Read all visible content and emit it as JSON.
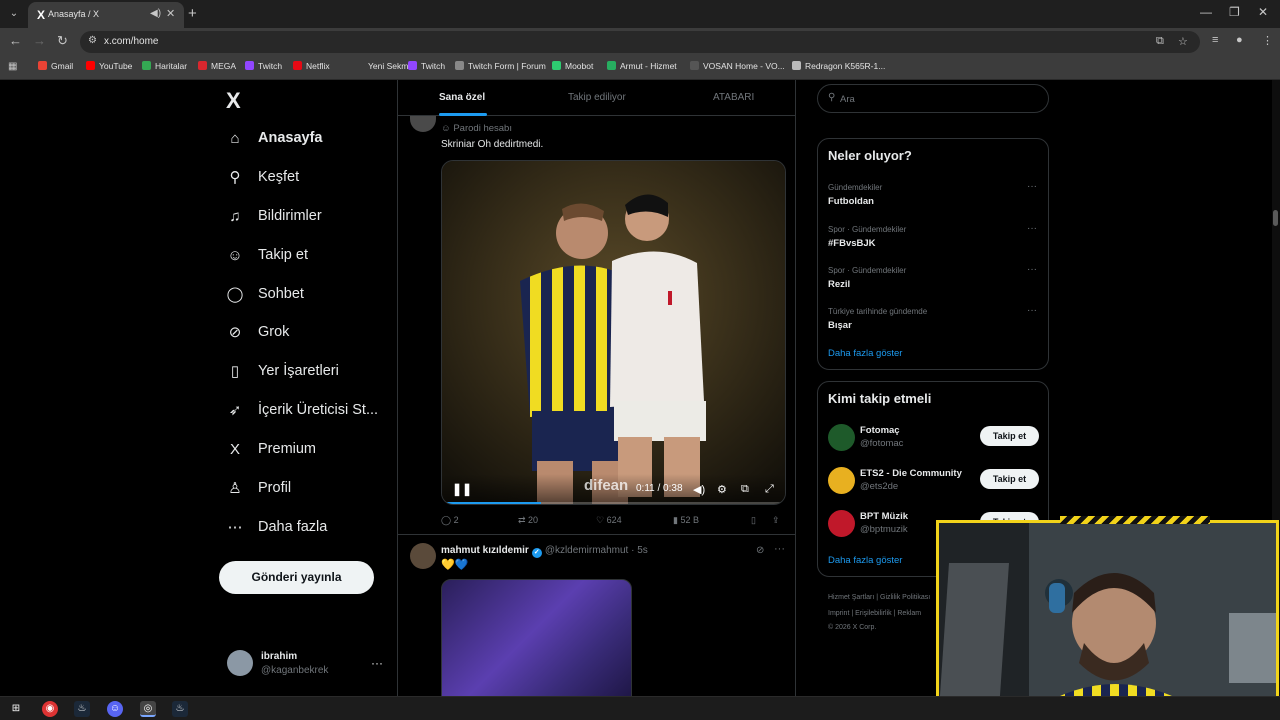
{
  "browser": {
    "tab_title": "Anasayfa / X",
    "url": "x.com/home",
    "bookmarks": [
      {
        "label": "Gmail",
        "color": "#ea4335"
      },
      {
        "label": "YouTube",
        "color": "#ff0000"
      },
      {
        "label": "Haritalar",
        "color": "#34a853"
      },
      {
        "label": "MEGA",
        "color": "#d9272e"
      },
      {
        "label": "Twitch",
        "color": "#9146ff"
      },
      {
        "label": "Netflix",
        "color": "#e50914"
      },
      {
        "label": "Yeni Sekme",
        "color": "#3c3c3c"
      },
      {
        "label": "Twitch",
        "color": "#9146ff"
      },
      {
        "label": "Twitch Form | Forum",
        "color": "#888888"
      },
      {
        "label": "Moobot",
        "color": "#2ecc71"
      },
      {
        "label": "Armut - Hizmet",
        "color": "#27ae60"
      },
      {
        "label": "VOSAN Home - VO...",
        "color": "#555555"
      },
      {
        "label": "Redragon K565R-1...",
        "color": "#bbbbbb"
      }
    ]
  },
  "sidebar": {
    "logo": "X",
    "items": [
      {
        "label": "Anasayfa",
        "icon": "home-icon",
        "glyph": "⌂",
        "active": true
      },
      {
        "label": "Keşfet",
        "icon": "search-icon",
        "glyph": "⚲"
      },
      {
        "label": "Bildirimler",
        "icon": "bell-icon",
        "glyph": "♫"
      },
      {
        "label": "Takip et",
        "icon": "follow-icon",
        "glyph": "☺"
      },
      {
        "label": "Sohbet",
        "icon": "chat-icon",
        "glyph": "◯"
      },
      {
        "label": "Grok",
        "icon": "grok-icon",
        "glyph": "⊘"
      },
      {
        "label": "Yer İşaretleri",
        "icon": "bookmark-icon",
        "glyph": "▯"
      },
      {
        "label": "İçerik Üreticisi St...",
        "icon": "rocket-icon",
        "glyph": "➶"
      },
      {
        "label": "Premium",
        "icon": "x-premium-icon",
        "glyph": "X"
      },
      {
        "label": "Profil",
        "icon": "profile-icon",
        "glyph": "♙"
      },
      {
        "label": "Daha fazla",
        "icon": "more-icon",
        "glyph": "⋯"
      }
    ],
    "post_button": "Gönderi yayınla",
    "account": {
      "name": "ibrahim",
      "handle": "@kaganbekrek"
    }
  },
  "timeline": {
    "tabs": [
      "Sana özel",
      "Takip ediliyor",
      "ATABARI"
    ],
    "tweet1": {
      "parody_label": "Parodi hesabı",
      "text": "Skriniar Oh dedirtmedi.",
      "video": {
        "time": "0:11 / 0:38",
        "progress": 0.29,
        "overlay_text": "difean"
      },
      "actions": {
        "replies": "2",
        "reposts": "20",
        "likes": "624",
        "views": "52 B"
      }
    },
    "tweet2": {
      "name": "mahmut kızıldemir",
      "handle": "@kzldemirmahmut · 5s",
      "text": "💛💙"
    }
  },
  "right": {
    "search_placeholder": "Ara",
    "trends_title": "Neler oluyor?",
    "trends": [
      {
        "meta": "Gündemdekiler",
        "name": "Futboldan"
      },
      {
        "meta": "Spor · Gündemdekiler",
        "name": "#FBvsBJK"
      },
      {
        "meta": "Spor · Gündemdekiler",
        "name": "Rezil"
      },
      {
        "meta": "Türkiye tarihinde gündemde",
        "name": "Bışar"
      }
    ],
    "trends_more": "Daha fazla göster",
    "wtf_title": "Kimi takip etmeli",
    "wtf": [
      {
        "name": "Fotomaç",
        "handle": "@fotomac",
        "avatar_color": "#1e5a2a"
      },
      {
        "name": "ETS2 - Die Community",
        "handle": "@ets2de",
        "avatar_color": "#e8b020"
      },
      {
        "name": "BPT Müzik",
        "handle": "@bptmuzik",
        "avatar_color": "#c0182a"
      }
    ],
    "follow_label": "Takip et",
    "wtf_more": "Daha fazla göster",
    "footer": [
      "Hizmet Şartları | Gizlilik Politikası",
      "Imprint | Erişilebilirlik | Reklam",
      "© 2026 X Corp."
    ]
  }
}
